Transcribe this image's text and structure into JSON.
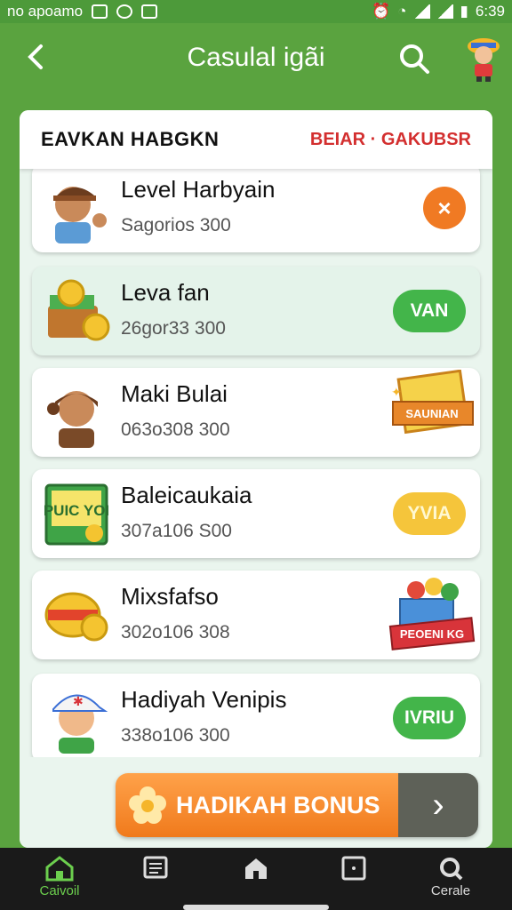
{
  "status_bar": {
    "left_text": "no apoamo",
    "time": "6:39"
  },
  "app_bar": {
    "title": "Casulal igãi"
  },
  "panel_header": {
    "left": "EAVKAN HABGKN",
    "right": "BEIAR · GAKUBSR"
  },
  "rows": [
    {
      "name": "Level Harbyain",
      "sub": "Sagorios 300",
      "action": "×",
      "action_type": "orange-x"
    },
    {
      "name": "Leva fan",
      "sub": "26gor33 300",
      "action": "VAN",
      "action_type": "green"
    },
    {
      "name": "Maki Bulai",
      "sub": "063o308 300",
      "action": "",
      "action_type": "badge",
      "badge_text": "SAUNIAN"
    },
    {
      "name": "Baleicaukaia",
      "sub": "307a106 S00",
      "action": "YVIA",
      "action_type": "yellow"
    },
    {
      "name": "Mixsfafso",
      "sub": "302o106 308",
      "action": "",
      "action_type": "badge",
      "badge_text": "PEOENI KG"
    },
    {
      "name": "Hadiyah Venipis",
      "sub": "338o106 300",
      "action": "IVRIU",
      "action_type": "green"
    }
  ],
  "thumb_texts": {
    "row4": "PUIC YOI"
  },
  "bonus": {
    "label": "HADIKAH BONUS",
    "arrow": "›"
  },
  "bottom_nav": [
    {
      "label": "Caivoil",
      "icon": "home-icon",
      "active": true
    },
    {
      "label": "",
      "icon": "list-icon",
      "active": false
    },
    {
      "label": "",
      "icon": "house-icon",
      "active": false
    },
    {
      "label": "",
      "icon": "square-icon",
      "active": false
    },
    {
      "label": "Cerale",
      "icon": "search-icon",
      "active": false
    }
  ],
  "colors": {
    "brand_green": "#5aa33f",
    "accent_orange": "#f07a23",
    "button_green": "#43b54a",
    "button_yellow": "#f5c53b",
    "header_red": "#d32f2f"
  }
}
